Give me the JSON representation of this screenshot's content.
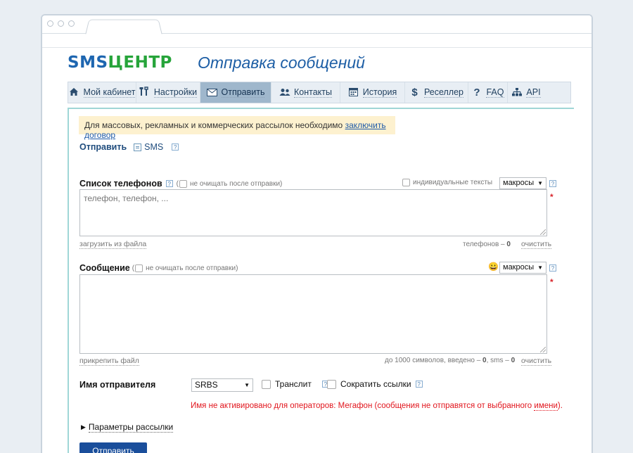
{
  "header": {
    "logo_sms": "SMS",
    "logo_centr": "ЦЕНТР",
    "page_title": "Отправка сообщений"
  },
  "nav": {
    "items": [
      {
        "label": "Мой кабинет",
        "icon": "home-icon"
      },
      {
        "label": "Настройки",
        "icon": "tools-icon"
      },
      {
        "label": "Отправить",
        "icon": "envelope-icon",
        "active": true
      },
      {
        "label": "Контакты",
        "icon": "contacts-icon"
      },
      {
        "label": "История",
        "icon": "calendar-icon"
      },
      {
        "label": "Реселлер",
        "icon": "dollar-icon"
      },
      {
        "label": "FAQ",
        "icon": "question-icon"
      },
      {
        "label": "API",
        "icon": "sitemap-icon"
      }
    ]
  },
  "notice": {
    "text": "Для массовых, рекламных и коммерческих рассылок необходимо ",
    "link": "заключить договор"
  },
  "send_line": {
    "label": "Отправить",
    "channel": "SMS",
    "help": "?"
  },
  "phones": {
    "label": "Список телефонов",
    "no_clear_label": "не очищать после отправки",
    "individual_label": "индивидуальные тексты",
    "macros": "макросы",
    "placeholder": "телефон, телефон, ...",
    "load_file": "загрузить из файла",
    "count_label": "телефонов – ",
    "count_value": "0",
    "clear": "очистить",
    "required": "*"
  },
  "message": {
    "label": "Сообщение",
    "no_clear_label": "не очищать после отправки",
    "emoji": "😀",
    "macros": "макросы",
    "attach": "прикрепить файл",
    "counter_prefix": "до 1000 символов, введено – ",
    "counter_entered": "0",
    "counter_mid": ", sms – ",
    "counter_sms": "0",
    "clear": "очистить",
    "required": "*"
  },
  "sender": {
    "label": "Имя отправителя",
    "value": "SRBS",
    "translit": "Транслит",
    "shorten": "Сократить ссылки"
  },
  "error": {
    "text": "Имя не активировано для операторов: Мегафон (сообщения не отправятся от выбранного ",
    "link": "имени",
    "tail": ")."
  },
  "params_label": "Параметры рассылки",
  "submit_label": "Отправить",
  "colors": {
    "accent": "#1a4e9b",
    "logo_green": "#26a43a",
    "error": "#e1151d",
    "notice_bg": "#fdf1cf"
  }
}
